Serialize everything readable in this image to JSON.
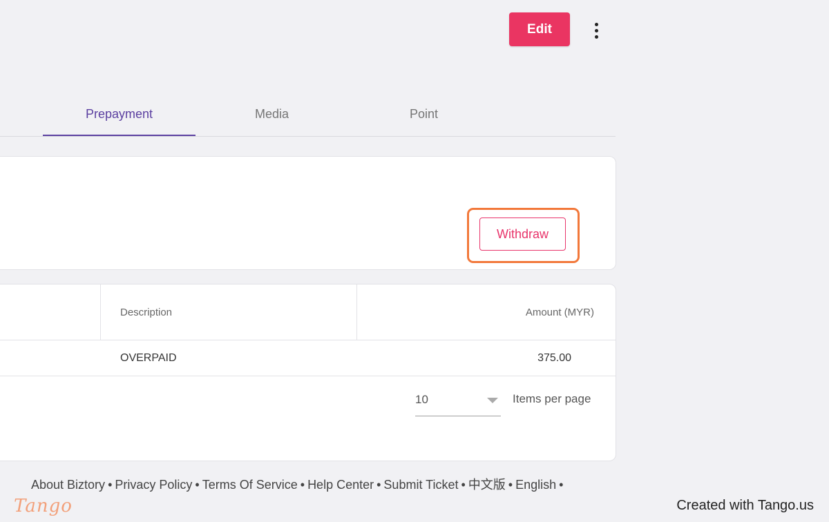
{
  "header": {
    "edit_label": "Edit",
    "more_icon": "more-vertical-icon"
  },
  "tabs": [
    {
      "label": "Prepayment",
      "active": true
    },
    {
      "label": "Media",
      "active": false
    },
    {
      "label": "Point",
      "active": false
    }
  ],
  "withdraw": {
    "button_label": "Withdraw"
  },
  "table": {
    "columns": [
      "Description",
      "Amount (MYR)"
    ],
    "rows": [
      {
        "description": "OVERPAID",
        "amount": "375.00"
      }
    ]
  },
  "pagination": {
    "page_size": "10",
    "label": "Items per page"
  },
  "footer": {
    "links": [
      "About Biztory",
      "Privacy Policy",
      "Terms Of Service",
      "Help Center",
      "Submit Ticket",
      "中文版",
      "English"
    ],
    "separator": "•"
  },
  "tango": {
    "logo": "Tango",
    "credit": "Created with Tango.us"
  },
  "colors": {
    "accent": "#ea3562",
    "tab_active": "#5b3fa0",
    "highlight": "#f2783a"
  }
}
